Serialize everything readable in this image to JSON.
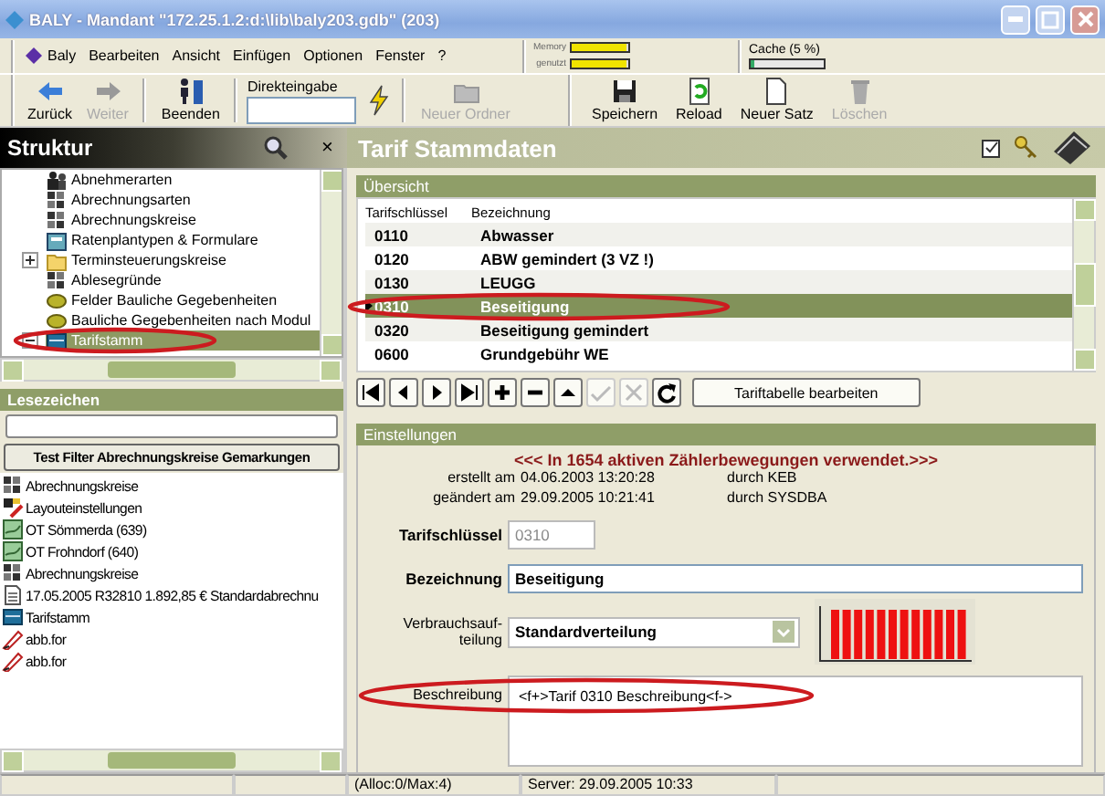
{
  "window": {
    "title": "BALY - Mandant \"172.25.1.2:d:\\lib\\baly203.gdb\" (203)"
  },
  "menu": [
    "Baly",
    "Bearbeiten",
    "Ansicht",
    "Einfügen",
    "Optionen",
    "Fenster",
    "?"
  ],
  "memory": [
    {
      "label": "Memory",
      "level": 0.95
    },
    {
      "label": "genutzt",
      "level": 0.95
    }
  ],
  "cache": {
    "label": "Cache (5 %)",
    "level": 0.05
  },
  "toolbar": {
    "left": [
      [
        {
          "kind": "back",
          "label": "Zurück",
          "disabled": false
        },
        {
          "kind": "forward",
          "label": "Weiter",
          "disabled": true
        }
      ],
      [
        {
          "kind": "exit",
          "label": "Beenden",
          "disabled": false
        }
      ],
      [
        {
          "kind": "input",
          "label": "Direkteingabe"
        },
        {
          "kind": "lightning"
        }
      ],
      [
        {
          "kind": "folder",
          "label": "Neuer Ordner",
          "disabled": true
        }
      ]
    ],
    "right": [
      {
        "kind": "save",
        "label": "Speichern",
        "disabled": false
      },
      {
        "kind": "reload",
        "label": "Reload",
        "disabled": false
      },
      {
        "kind": "new",
        "label": "Neuer Satz",
        "disabled": false
      },
      {
        "kind": "delete",
        "label": "Löschen",
        "disabled": true
      }
    ]
  },
  "structure": {
    "title": "Struktur",
    "close": "×",
    "tree": [
      {
        "label": "Abnehmerarten",
        "kind": "people",
        "selected": false
      },
      {
        "label": "Abrechnungsarten",
        "kind": "grid",
        "selected": false
      },
      {
        "label": "Abrechnungskreise",
        "kind": "grid",
        "selected": false
      },
      {
        "label": "Ratenplantypen & Formulare",
        "kind": "calc",
        "selected": false
      },
      {
        "label": "Terminsteuerungskreise",
        "kind": "folder",
        "selected": false,
        "expanded": false
      },
      {
        "label": "Ablesegründe",
        "kind": "grid",
        "selected": false
      },
      {
        "label": "Felder Bauliche Gegebenheiten",
        "kind": "leaf",
        "selected": false
      },
      {
        "label": "Bauliche Gegebenheiten nach Modul",
        "kind": "leaf",
        "selected": false
      },
      {
        "label": "Tarifstamm",
        "kind": "table",
        "selected": true,
        "expanded": true
      }
    ]
  },
  "bookmarks": {
    "title": "Lesezeichen",
    "button": "Test Filter Abrechnungskreise Gemarkungen",
    "items": [
      {
        "label": "Abrechnungskreise",
        "kind": "grid"
      },
      {
        "label": "Layouteinstellungen",
        "kind": "layout"
      },
      {
        "label": "OT Sömmerda (639)",
        "kind": "map"
      },
      {
        "label": "OT Frohndorf (640)",
        "kind": "map"
      },
      {
        "label": "Abrechnungskreise",
        "kind": "grid"
      },
      {
        "label": "17.05.2005 R32810 1.892,85 € Standardabrechnu",
        "kind": "doc"
      },
      {
        "label": "Tarifstamm",
        "kind": "table"
      },
      {
        "label": "abb.for",
        "kind": "pen"
      },
      {
        "label": "abb.for",
        "kind": "pen"
      }
    ]
  },
  "detail": {
    "title": "Tarif Stammdaten",
    "overview": {
      "title": "Übersicht",
      "columns": [
        "Tarifschlüssel",
        "Bezeichnung"
      ],
      "rows": [
        {
          "key": "0110",
          "name": "Abwasser",
          "selected": false
        },
        {
          "key": "0120",
          "name": "ABW gemindert (3 VZ !)",
          "selected": false
        },
        {
          "key": "0130",
          "name": "LEUGG",
          "selected": false
        },
        {
          "key": "0310",
          "name": "Beseitigung",
          "selected": true
        },
        {
          "key": "0320",
          "name": "Beseitigung gemindert",
          "selected": false
        },
        {
          "key": "0600",
          "name": "Grundgebühr WE",
          "selected": false
        }
      ]
    },
    "nav": [
      {
        "kind": "first",
        "disabled": false
      },
      {
        "kind": "prev",
        "disabled": false
      },
      {
        "kind": "next",
        "disabled": false
      },
      {
        "kind": "last",
        "disabled": false
      },
      {
        "kind": "add",
        "disabled": false
      },
      {
        "kind": "remove",
        "disabled": false
      },
      {
        "kind": "up",
        "disabled": false
      },
      {
        "kind": "confirm",
        "disabled": true
      },
      {
        "kind": "cancel",
        "disabled": true
      },
      {
        "kind": "refresh",
        "disabled": false
      }
    ],
    "nav_button": "Tariftabelle bearbeiten",
    "settings": {
      "title": "Einstellungen",
      "notice": "<<< In 1654 aktiven Zählerbewegungen verwendet.>>>",
      "audit": [
        {
          "label": "erstellt am",
          "value": "04.06.2003 13:20:28",
          "by": "durch KEB"
        },
        {
          "label": "geändert am",
          "value": "29.09.2005 10:21:41",
          "by": "durch SYSDBA"
        }
      ],
      "key": {
        "label": "Tarifschlüssel",
        "value": "0310",
        "disabled": true
      },
      "name": {
        "label": "Bezeichnung",
        "value": "Beseitigung"
      },
      "distribution": {
        "label": "Verbrauchsauf-teilung",
        "value": "Standardverteilung"
      },
      "description": {
        "label": "Beschreibung",
        "value": "<f+>Tarif 0310 Beschreibung<f->"
      }
    }
  },
  "status_bar": [
    "(Alloc:0/Max:4)",
    "Server: 29.09.2005 10:33"
  ]
}
